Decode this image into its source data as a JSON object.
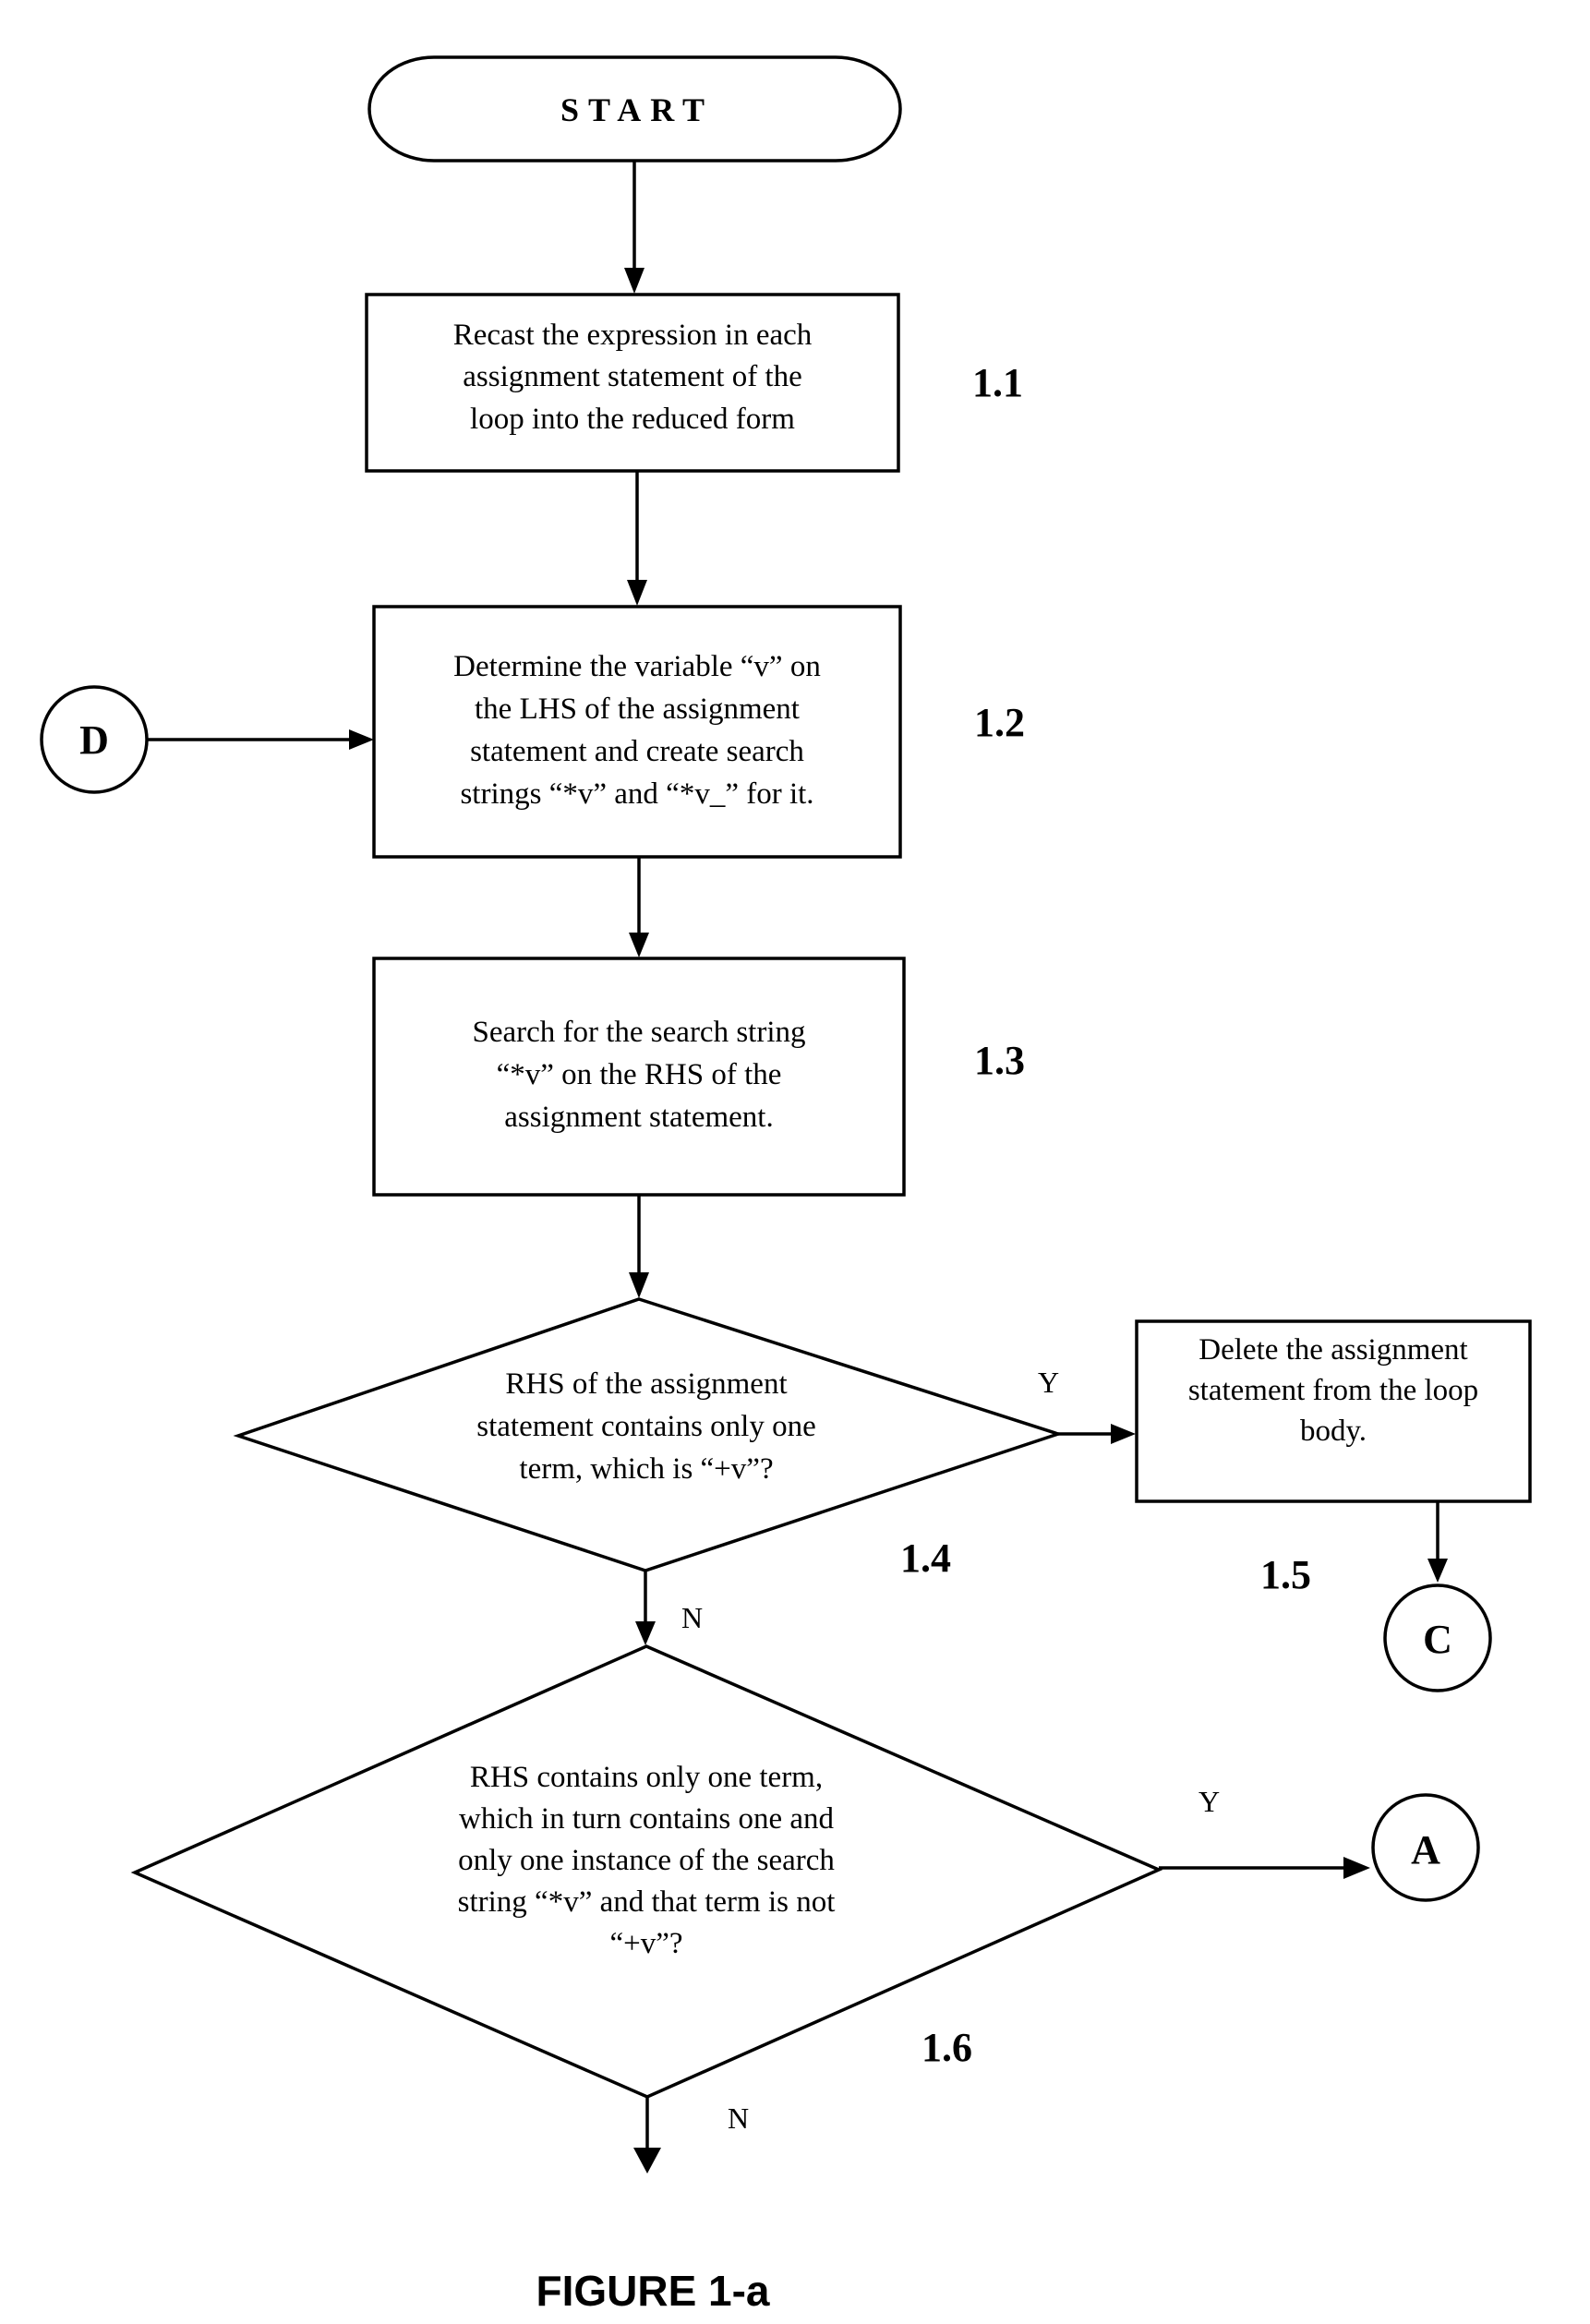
{
  "figure": {
    "caption": "FIGURE 1-a",
    "start": {
      "label": "START"
    },
    "steps": [
      {
        "id": "1.1",
        "type": "process",
        "lines": [
          "Recast the expression in each",
          "assignment statement of the",
          "loop into the reduced form"
        ]
      },
      {
        "id": "1.2",
        "type": "process",
        "lines": [
          "Determine the variable “v” on",
          "the LHS of the assignment",
          "statement and create search",
          "strings “*v” and “*v_” for it."
        ]
      },
      {
        "id": "1.3",
        "type": "process",
        "lines": [
          "Search for the search string",
          "“*v” on the RHS of the",
          "assignment statement."
        ]
      },
      {
        "id": "1.4",
        "type": "decision",
        "lines": [
          "RHS of the assignment",
          "statement contains only one",
          "term, which is “+v”?"
        ],
        "yes_label": "Y",
        "no_label": "N"
      },
      {
        "id": "1.5",
        "type": "process",
        "lines": [
          "Delete the assignment",
          "statement from the loop",
          "body."
        ]
      },
      {
        "id": "1.6",
        "type": "decision",
        "lines": [
          "RHS contains only one term,",
          "which in turn contains one and",
          "only one instance of the search",
          "string “*v” and that term is not",
          "“+v”?"
        ],
        "yes_label": "Y",
        "no_label": "N"
      }
    ],
    "connectors": {
      "D": "D",
      "C": "C",
      "A": "A"
    }
  }
}
